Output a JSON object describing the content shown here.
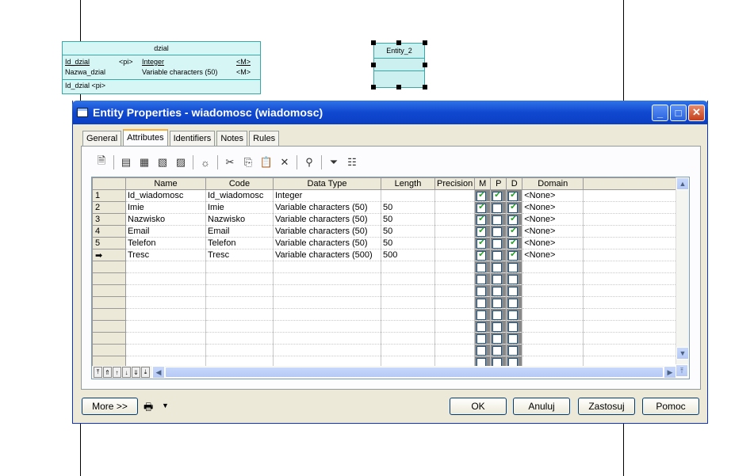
{
  "canvas": {
    "entity_dzial": {
      "title": "dzial",
      "attributes": [
        {
          "name": "Id_dzial",
          "flag": "<pi>",
          "type": "Integer",
          "mandatory": "<M>"
        },
        {
          "name": "Nazwa_dzial",
          "flag": "",
          "type": "Variable characters (50)",
          "mandatory": "<M>"
        }
      ],
      "identifier": "Id_dzial <pi>"
    },
    "entity_2": {
      "title": "Entity_2"
    }
  },
  "window": {
    "title": "Entity Properties - wiadomosc (wiadomosc)",
    "tabs": [
      "General",
      "Attributes",
      "Identifiers",
      "Notes",
      "Rules"
    ],
    "active_tab": "Attributes"
  },
  "grid": {
    "columns": [
      "Name",
      "Code",
      "Data Type",
      "Length",
      "Precision",
      "M",
      "P",
      "D",
      "Domain"
    ],
    "rows": [
      {
        "num": "1",
        "name": "Id_wiadomosc",
        "code": "Id_wiadomosc",
        "type": "Integer",
        "length": "",
        "precision": "",
        "m": true,
        "p": true,
        "d": true,
        "domain": "<None>"
      },
      {
        "num": "2",
        "name": "Imie",
        "code": "Imie",
        "type": "Variable characters (50)",
        "length": "50",
        "precision": "",
        "m": true,
        "p": false,
        "d": true,
        "domain": "<None>"
      },
      {
        "num": "3",
        "name": "Nazwisko",
        "code": "Nazwisko",
        "type": "Variable characters (50)",
        "length": "50",
        "precision": "",
        "m": true,
        "p": false,
        "d": true,
        "domain": "<None>"
      },
      {
        "num": "4",
        "name": "Email",
        "code": "Email",
        "type": "Variable characters (50)",
        "length": "50",
        "precision": "",
        "m": true,
        "p": false,
        "d": true,
        "domain": "<None>"
      },
      {
        "num": "5",
        "name": "Telefon",
        "code": "Telefon",
        "type": "Variable characters (50)",
        "length": "50",
        "precision": "",
        "m": true,
        "p": false,
        "d": true,
        "domain": "<None>"
      },
      {
        "num": "➡",
        "name": "Tresc",
        "code": "Tresc",
        "type": "Variable characters (500)",
        "length": "500",
        "precision": "",
        "m": true,
        "p": false,
        "d": true,
        "domain": "<None>"
      }
    ],
    "empty_rows": 9
  },
  "buttons": {
    "more": "More >>",
    "ok": "OK",
    "cancel": "Anuluj",
    "apply": "Zastosuj",
    "help": "Pomoc"
  }
}
